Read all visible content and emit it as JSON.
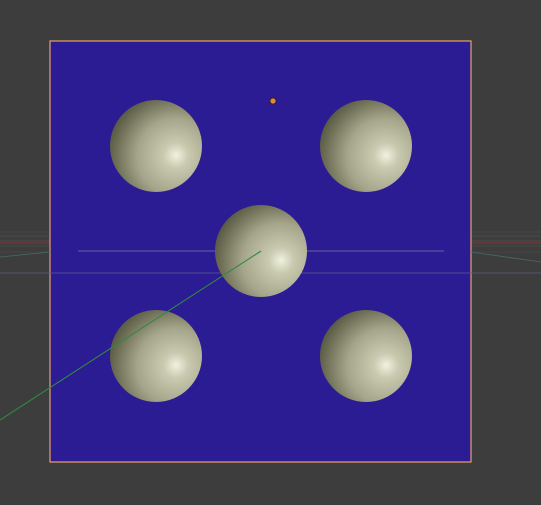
{
  "viewport": {
    "background_color": "#3d3d3d",
    "grid_color": "#4a4a4a",
    "x_axis_color": "#8a3a3a",
    "y_axis_color": "#3a7a3a"
  },
  "plane": {
    "fill_color": "#2c1c94",
    "edge_color": "#e8a16a",
    "selected": true
  },
  "spheres": {
    "count": 5,
    "material": "grey-metallic",
    "highlight_color": "#e6e8d2",
    "base_color": "#b6b79c",
    "shadow_color": "#59593f"
  },
  "origin_marker": {
    "color": "#e08a3a"
  }
}
